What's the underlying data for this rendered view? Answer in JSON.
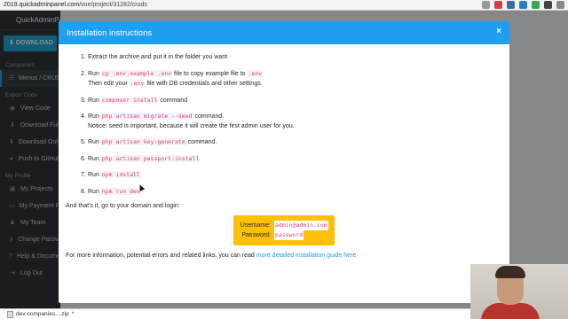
{
  "browser": {
    "url_host": "2019.quickadminpanel.com",
    "url_path": "/vue/project/31282/cruds",
    "extensions": [
      {
        "icon": "star-icon",
        "color": "#999999"
      },
      {
        "icon": "shield-icon",
        "color": "#d04040"
      },
      {
        "icon": "grid-icon",
        "color": "#3a6ea5"
      },
      {
        "icon": "ext-icon",
        "color": "#2a7ad4"
      },
      {
        "icon": "ext-icon",
        "color": "#3aa757"
      },
      {
        "icon": "ext-icon",
        "color": "#444444"
      },
      {
        "icon": "puzzle-icon",
        "color": "#888888"
      }
    ]
  },
  "sidebar": {
    "brand": "QuickAdminPanel",
    "download_label": "DOWNLOAD",
    "sections": [
      {
        "title": "Companies",
        "items": [
          {
            "label": "Menus / CRUDs",
            "icon": "list-icon",
            "active": true
          }
        ]
      },
      {
        "title": "Export Code",
        "items": [
          {
            "label": "View Code",
            "icon": "eye-icon"
          },
          {
            "label": "Download Full",
            "icon": "download-icon"
          },
          {
            "label": "Download Only",
            "icon": "download-icon"
          },
          {
            "label": "Push to GitHub",
            "icon": "github-icon"
          }
        ]
      },
      {
        "title": "My Profile",
        "items": [
          {
            "label": "My Projects",
            "icon": "folder-icon"
          },
          {
            "label": "My Payment Plans",
            "icon": "card-icon"
          },
          {
            "label": "My Team",
            "icon": "users-icon"
          },
          {
            "label": "Change Password",
            "icon": "key-icon"
          },
          {
            "label": "Help & Documentation",
            "icon": "help-icon"
          },
          {
            "label": "Log Out",
            "icon": "logout-icon"
          }
        ]
      }
    ]
  },
  "modal": {
    "title": "Installation instructions",
    "close_label": "×",
    "steps": [
      {
        "n": "1.",
        "pre": "Extract the archive and put it in the folder you want"
      },
      {
        "n": "2.",
        "pre": "Run",
        "code1": "cp .env.example .env",
        "mid": "file to copy example file to",
        "code2": ".env",
        "line2_pre": "Then edit your",
        "line2_code": ".env",
        "line2_post": "file with DB credentials and other settings."
      },
      {
        "n": "3.",
        "pre": "Run",
        "code1": "composer install",
        "post": "command"
      },
      {
        "n": "4.",
        "pre": "Run",
        "code1": "php artisan migrate --seed",
        "post": "command.",
        "line2": "Notice: seed is important, because it will create the first admin user for you."
      },
      {
        "n": "5.",
        "pre": "Run",
        "code1": "php artisan key:generate",
        "post": "command."
      },
      {
        "n": "6.",
        "pre": "Run",
        "code1": "php artisan passport:install"
      },
      {
        "n": "7.",
        "pre": "Run",
        "code1": "npm install"
      },
      {
        "n": "8.",
        "pre": "Run",
        "code1": "npm run dev"
      }
    ],
    "done_text": "And that's it, go to your domain and login:",
    "login": {
      "username_label": "Username:",
      "username": "admin@admin.com",
      "password_label": "Password:",
      "password": "password"
    },
    "more_info_text": "For more information, potential errors and related links, you can read",
    "more_info_link": "more detailed installation guide here"
  },
  "download_bar": {
    "file": "dev-companies....zip",
    "chevron": "^"
  }
}
